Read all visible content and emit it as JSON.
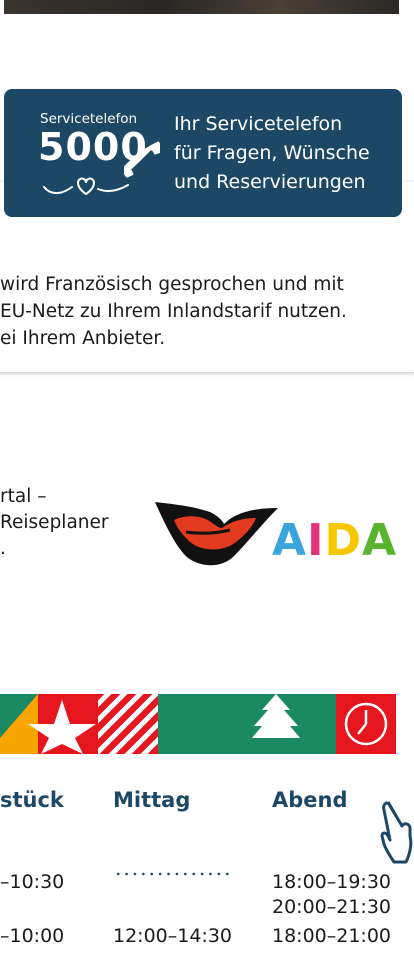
{
  "service": {
    "logo_small": "Servicetelefon",
    "logo_number": "5000",
    "lines": [
      "Ihr Servicetelefon",
      "für Fragen, Wünsche",
      "und Reservierungen"
    ],
    "bg_color": "#1c4866"
  },
  "info_bubble": {
    "lines": [
      "wird Französisch gesprochen und mit",
      "EU-Netz zu Ihrem Inlandstarif nutzen.",
      "ei Ihrem Anbieter."
    ]
  },
  "portal": {
    "lines": [
      "rtal –",
      "Reiseplaner",
      "."
    ],
    "brand": {
      "letters": [
        "A",
        "I",
        "D",
        "A"
      ],
      "colors": [
        "#3aa5dc",
        "#e2337a",
        "#f6c600",
        "#58b42f"
      ]
    }
  },
  "icon_band": {
    "icons": [
      "star-icon",
      "stripes-icon",
      "tree-icon",
      "clock-icon"
    ],
    "colors": [
      "#1b8a63",
      "#e5161e",
      "#f7a600",
      "#ffffff"
    ]
  },
  "meals": {
    "headers": [
      "stück",
      "Mittag",
      "Abend"
    ],
    "rows": [
      {
        "breakfast": "–10:30",
        "lunch": "",
        "dinner": [
          "18:00–19:30",
          "20:00–21:30"
        ]
      },
      {
        "breakfast": "–10:00",
        "lunch": "12:00–14:30",
        "dinner": [
          "18:00–21:00"
        ]
      }
    ]
  },
  "icons": {
    "phone": "phone-icon",
    "heart": "heart-icon",
    "swipe": "swipe-hand-icon",
    "lips": "lips-logo-icon"
  }
}
